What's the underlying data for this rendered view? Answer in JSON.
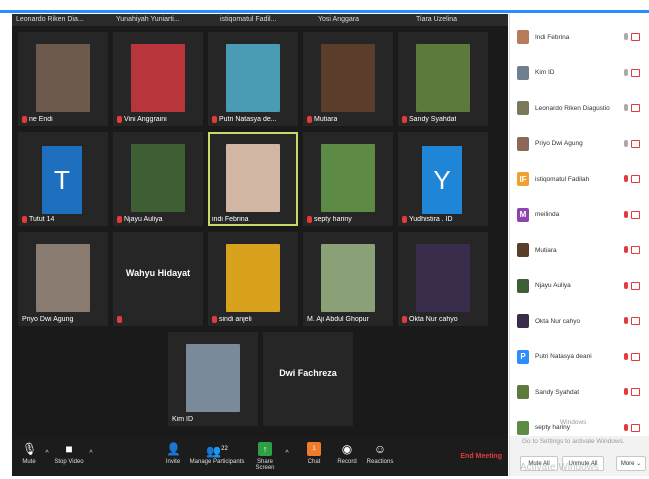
{
  "top_names": [
    "Leonardo Riken Dia...",
    "Yunahiyah Yuniarti...",
    "istiqomatul Fadil...",
    "Yosi Anggara",
    "Tiara Uzelina"
  ],
  "tiles": [
    {
      "name": "ne Endi",
      "muted": true,
      "photo_color": "#6d5a4c"
    },
    {
      "name": "Vini Anggraini",
      "muted": true,
      "photo_color": "#b8353b"
    },
    {
      "name": "Putri Natasya de...",
      "muted": true,
      "photo_color": "#4a9bb4"
    },
    {
      "name": "Mutiara",
      "muted": true,
      "photo_color": "#5a3d2b"
    },
    {
      "name": "Sandy Syahdat",
      "muted": true,
      "photo_color": "#5d7a3c"
    },
    {
      "name": "Tutut 14",
      "muted": true,
      "letter": "T",
      "letter_color": "#1f6fbf"
    },
    {
      "name": "Njayu Auliya",
      "muted": true,
      "photo_color": "#3e5f34"
    },
    {
      "name": "indi Febrina",
      "muted": false,
      "active": true,
      "photo_color": "#d1b6a4"
    },
    {
      "name": "septy hariny",
      "muted": true,
      "photo_color": "#5d8a45"
    },
    {
      "name": "Yudhistira . ID",
      "muted": true,
      "letter": "Y",
      "letter_color": "#1f85d6"
    },
    {
      "name": "Priyo Dwi Agung",
      "muted": false,
      "photo_color": "#8a7b70"
    },
    {
      "name": "",
      "muted": true,
      "bigname": "Wahyu Hidayat"
    },
    {
      "name": "sindi anjeli",
      "muted": true,
      "photo_color": "#d9a21e"
    },
    {
      "name": "M. Aji Abdul Ghopur",
      "muted": false,
      "photo_color": "#8aa076"
    },
    {
      "name": "Okta Nur cahyo",
      "muted": true,
      "photo_color": "#3a2d4c"
    },
    {
      "name": "Kim ID",
      "muted": false,
      "photo_color": "#7a8a9a"
    },
    {
      "name": "",
      "muted": false,
      "bigname": "Dwi Fachreza"
    }
  ],
  "toolbar": {
    "mute": "Mute",
    "stop_video": "Stop Video",
    "invite": "Invite",
    "manage": "Manage Participants",
    "participants_count": "22",
    "share": "Share Screen",
    "chat": "Chat",
    "chat_badge": "1",
    "record": "Record",
    "reactions": "Reactions",
    "end": "End Meeting"
  },
  "participants": [
    {
      "name": "Indi Febrina",
      "mic_off": false,
      "color": "#b77a5a"
    },
    {
      "name": "Kim ID",
      "mic_off": false,
      "color": "#6f7f8f"
    },
    {
      "name": "Leonardo Riken Diagustio",
      "mic_off": false,
      "color": "#7a7a5a"
    },
    {
      "name": "Priyo Dwi Agung",
      "mic_off": false,
      "color": "#8a6a55"
    },
    {
      "name": "istiqomatul Fadilah",
      "mic_off": true,
      "color": "#f0a030",
      "letter": "IF"
    },
    {
      "name": "meilinda",
      "mic_off": true,
      "color": "#8e44ad",
      "letter": "M"
    },
    {
      "name": "Mutiara",
      "mic_off": true,
      "color": "#5a3d2b"
    },
    {
      "name": "Njayu Auliya",
      "mic_off": true,
      "color": "#3e5f34"
    },
    {
      "name": "Okta Nur cahyo",
      "mic_off": true,
      "color": "#3a2d4c"
    },
    {
      "name": "Putri Natasya deani",
      "mic_off": true,
      "color": "#2d8cff",
      "letter": "P"
    },
    {
      "name": "Sandy Syahdat",
      "mic_off": true,
      "color": "#5d7a3c"
    },
    {
      "name": "septy hariny",
      "mic_off": true,
      "color": "#5d8a45"
    }
  ],
  "panel_footer": {
    "mute_all": "Mute All",
    "unmute_all": "Unmute All",
    "more": "More ⌄"
  },
  "watermark": {
    "small_top": "Windows",
    "line1": "Go to Settings to activate Windows.",
    "line2": "Activate Windows"
  }
}
